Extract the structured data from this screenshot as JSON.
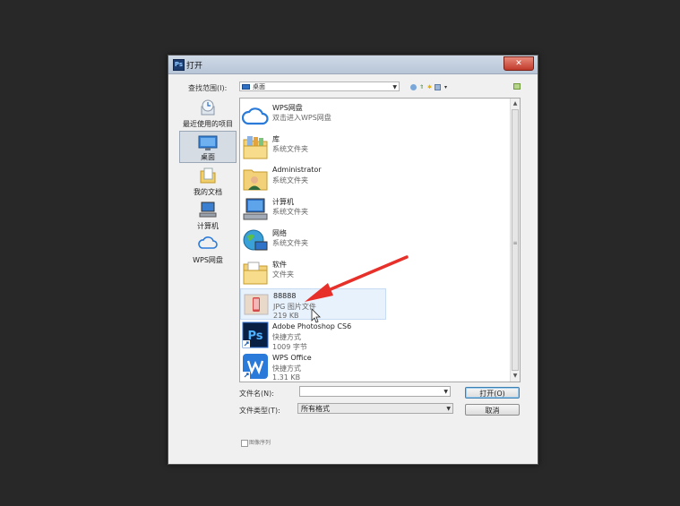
{
  "dialog": {
    "title": "打开",
    "close_glyph": "✕"
  },
  "lookin": {
    "label": "查找范围(I):",
    "value": "桌面"
  },
  "places": [
    {
      "label": "最近使用的项目",
      "icon": "recent-icon"
    },
    {
      "label": "桌面",
      "icon": "desktop-icon",
      "selected": true
    },
    {
      "label": "我的文档",
      "icon": "documents-icon"
    },
    {
      "label": "计算机",
      "icon": "computer-icon"
    },
    {
      "label": "WPS网盘",
      "icon": "cloud-icon"
    }
  ],
  "files": [
    {
      "name": "WPS网盘",
      "type": "双击进入WPS网盘",
      "size": "",
      "icon": "cloud-icon"
    },
    {
      "name": "库",
      "type": "系统文件夹",
      "size": "",
      "icon": "library-folder-icon"
    },
    {
      "name": "Administrator",
      "type": "系统文件夹",
      "size": "",
      "icon": "user-folder-icon"
    },
    {
      "name": "计算机",
      "type": "系统文件夹",
      "size": "",
      "icon": "computer-icon"
    },
    {
      "name": "网络",
      "type": "系统文件夹",
      "size": "",
      "icon": "network-icon"
    },
    {
      "name": "软件",
      "type": "文件夹",
      "size": "",
      "icon": "folder-icon"
    },
    {
      "name": "88888",
      "type": "JPG 图片文件",
      "size": "219 KB",
      "icon": "image-thumbnail-icon"
    },
    {
      "name": "Adobe Photoshop CS6",
      "type": "快捷方式",
      "size": "1009 字节",
      "icon": "photoshop-icon"
    },
    {
      "name": "WPS Office",
      "type": "快捷方式",
      "size": "1.31 KB",
      "icon": "wps-office-icon"
    }
  ],
  "filename": {
    "label": "文件名(N):",
    "value": ""
  },
  "filetype": {
    "label": "文件类型(T):",
    "value": "所有格式"
  },
  "buttons": {
    "open": "打开(O)",
    "cancel": "取消"
  },
  "checkbox": {
    "label": "图像序列"
  },
  "colors": {
    "background": "#282828",
    "annotation_arrow": "#e8302a",
    "selection": "#e8f2fd"
  }
}
